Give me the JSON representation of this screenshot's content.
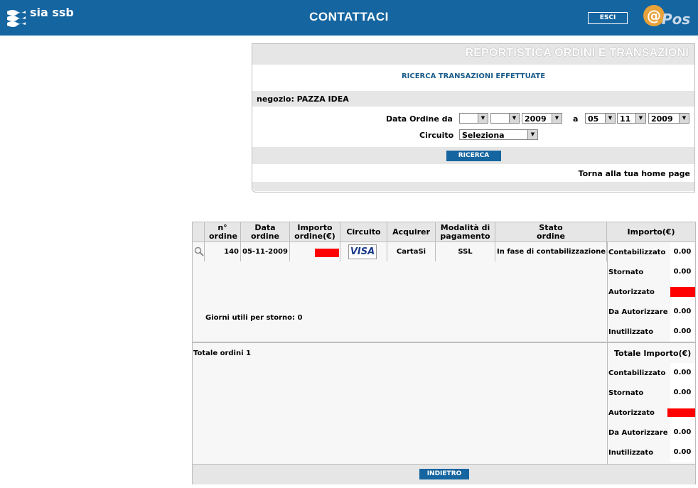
{
  "header": {
    "logo_text": "sia ssb",
    "title": "CONTATTACI",
    "exit_label": "ESCI",
    "brand_at": "@",
    "brand_pos": "Pos"
  },
  "panel": {
    "heading": "REPORTISTICA ORDINI E TRANSAZIONI",
    "subtitle": "RICERCA TRANSAZIONI EFFETTUATE",
    "shop_label": "negozio: PAZZA IDEA",
    "date_from_label": "Data Ordine da",
    "from_day": "",
    "from_month": "",
    "from_year": "2009",
    "to_label": "a",
    "to_day": "05",
    "to_month": "11",
    "to_year": "2009",
    "circuit_label": "Circuito",
    "circuit_value": "Seleziona",
    "search_label": "RICERCA",
    "home_link": "Torna alla tua home page"
  },
  "table": {
    "headers": {
      "order_no": "n° ordine",
      "order_date": "Data ordine",
      "amount": "Importo ordine(€)",
      "circuit": "Circuito",
      "acquirer": "Acquirer",
      "payment": "Modalità di pagamento",
      "status": "Stato ordine",
      "importo": "Importo(€)"
    },
    "row": {
      "order_no": "140",
      "order_date": "05-11-2009",
      "circuit_logo": "VISA",
      "acquirer": "CartaSi",
      "payment": "SSL",
      "status": "In fase di contabilizzazione"
    },
    "amounts": [
      {
        "label": "Contabilizzato",
        "value": "0.00"
      },
      {
        "label": "Stornato",
        "value": "0.00"
      },
      {
        "label": "Autorizzato",
        "value": ""
      },
      {
        "label": "Da Autorizzare",
        "value": "0.00"
      },
      {
        "label": "Inutilizzato",
        "value": "0.00"
      }
    ],
    "storno_days": "Giorni utili per storno: 0",
    "total_orders": "Totale ordini 1",
    "total_header": "Totale Importo(€)",
    "totals": [
      {
        "label": "Contabilizzato",
        "value": "0.00"
      },
      {
        "label": "Stornato",
        "value": "0.00"
      },
      {
        "label": "Autorizzato",
        "value": ""
      },
      {
        "label": "Da Autorizzare",
        "value": "0.00"
      },
      {
        "label": "Inutilizzato",
        "value": "0.00"
      }
    ],
    "back_label": "INDIETRO"
  },
  "colors": {
    "header_bg": "#1565a0",
    "panel_gray": "#e6e6e6",
    "redacted": "#ff0000",
    "accent_text": "#1a5b8a"
  }
}
